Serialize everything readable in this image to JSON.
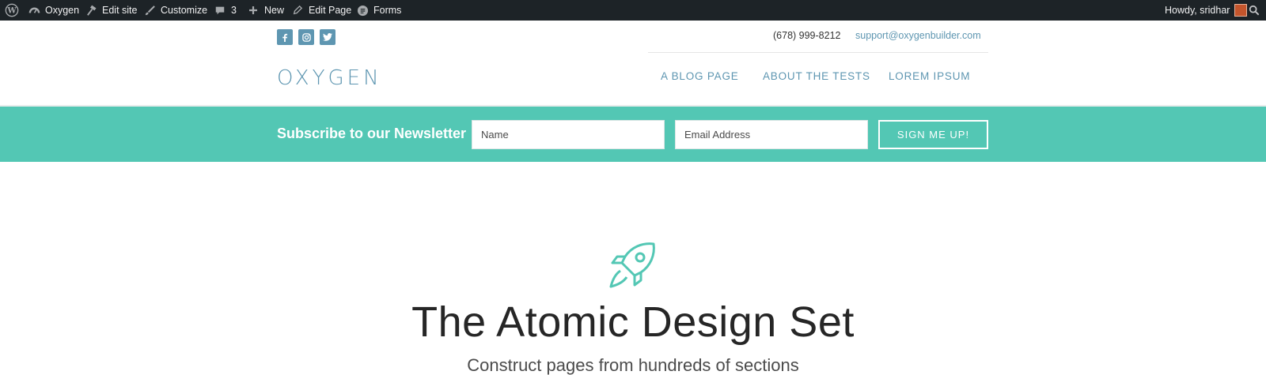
{
  "admin_bar": {
    "site_name": "Oxygen",
    "edit_site": "Edit site",
    "customize": "Customize",
    "comments_count": "3",
    "new": "New",
    "edit_page": "Edit Page",
    "forms": "Forms",
    "greeting": "Howdy, sridhar"
  },
  "header": {
    "phone": "(678) 999-8212",
    "email": "support@oxygenbuilder.com",
    "logo": "OXYGEN",
    "nav": [
      "A BLOG PAGE",
      "ABOUT THE TESTS",
      "LOREM IPSUM"
    ],
    "social": [
      "facebook-icon",
      "instagram-icon",
      "twitter-icon"
    ]
  },
  "newsletter": {
    "title": "Subscribe to our Newsletter",
    "name_placeholder": "Name",
    "email_placeholder": "Email Address",
    "button": "SIGN ME UP!"
  },
  "hero": {
    "icon": "rocket-icon",
    "title": "The Atomic Design Set",
    "subtitle": "Construct pages from hundreds of sections"
  },
  "colors": {
    "admin_bar_bg": "#1d2327",
    "brand_blue": "#5e96b1",
    "newsletter_bg": "#53c7b4"
  }
}
